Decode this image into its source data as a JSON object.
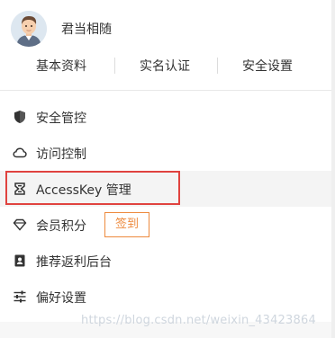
{
  "user": {
    "name": "君当相随"
  },
  "profile_tabs": [
    {
      "label": "基本资料"
    },
    {
      "label": "实名认证"
    },
    {
      "label": "安全设置"
    }
  ],
  "menu": {
    "items": [
      {
        "label": "安全管控",
        "icon": "shield-icon"
      },
      {
        "label": "访问控制",
        "icon": "cloud-icon"
      },
      {
        "label": "AccessKey 管理",
        "icon": "key-icon"
      },
      {
        "label": "会员积分",
        "icon": "diamond-icon"
      },
      {
        "label": "推荐返利后台",
        "icon": "id-card-icon"
      },
      {
        "label": "偏好设置",
        "icon": "sliders-icon"
      }
    ],
    "signin_label": "签到"
  },
  "watermark": "https://blog.csdn.net/weixin_43423864",
  "colors": {
    "highlight_border": "#e0433f",
    "signin_accent": "#ed8a3e",
    "active_bg": "#f4f4f4"
  }
}
